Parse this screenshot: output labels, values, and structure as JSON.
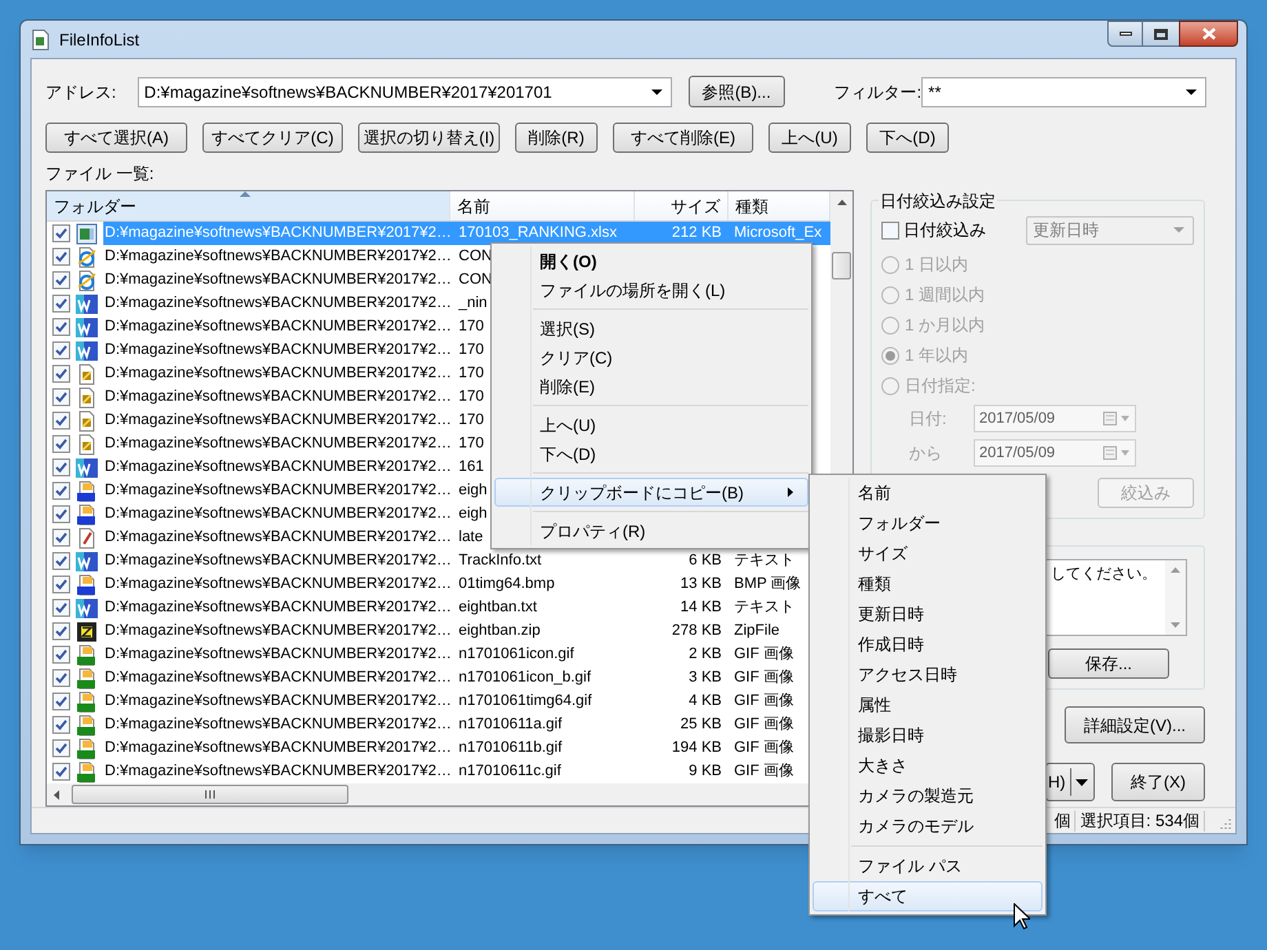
{
  "window": {
    "title": "FileInfoList"
  },
  "address": {
    "label": "アドレス:",
    "value": "D:¥magazine¥softnews¥BACKNUMBER¥2017¥201701"
  },
  "browse_button": "参照(B)...",
  "filter": {
    "label": "フィルター:",
    "value": "**"
  },
  "toolbar": [
    "すべて選択(A)",
    "すべてクリア(C)",
    "選択の切り替え(I)",
    "削除(R)",
    "すべて削除(E)",
    "上へ(U)",
    "下へ(D)"
  ],
  "list_label": "ファイル 一覧:",
  "table": {
    "columns": [
      "フォルダー",
      "名前",
      "サイズ",
      "種類"
    ],
    "rows": [
      {
        "kind": "excel",
        "checked": true,
        "selected": true,
        "folder": "D:¥magazine¥softnews¥BACKNUMBER¥2017¥2…",
        "name": "170103_RANKING.xlsx",
        "size": "212 KB",
        "type": "Microsoft_Ex"
      },
      {
        "kind": "web",
        "checked": true,
        "selected": false,
        "folder": "D:¥magazine¥softnews¥BACKNUMBER¥2017¥2…",
        "name": "CON"
      },
      {
        "kind": "web",
        "checked": true,
        "selected": false,
        "folder": "D:¥magazine¥softnews¥BACKNUMBER¥2017¥2…",
        "name": "CON"
      },
      {
        "kind": "wz",
        "checked": true,
        "selected": false,
        "folder": "D:¥magazine¥softnews¥BACKNUMBER¥2017¥2…",
        "name": "_nin"
      },
      {
        "kind": "wz",
        "checked": true,
        "selected": false,
        "folder": "D:¥magazine¥softnews¥BACKNUMBER¥2017¥2…",
        "name": "170"
      },
      {
        "kind": "wz",
        "checked": true,
        "selected": false,
        "folder": "D:¥magazine¥softnews¥BACKNUMBER¥2017¥2…",
        "name": "170"
      },
      {
        "kind": "script",
        "checked": true,
        "selected": false,
        "folder": "D:¥magazine¥softnews¥BACKNUMBER¥2017¥2…",
        "name": "170"
      },
      {
        "kind": "script",
        "checked": true,
        "selected": false,
        "folder": "D:¥magazine¥softnews¥BACKNUMBER¥2017¥2…",
        "name": "170"
      },
      {
        "kind": "script",
        "checked": true,
        "selected": false,
        "folder": "D:¥magazine¥softnews¥BACKNUMBER¥2017¥2…",
        "name": "170"
      },
      {
        "kind": "script",
        "checked": true,
        "selected": false,
        "folder": "D:¥magazine¥softnews¥BACKNUMBER¥2017¥2…",
        "name": "170"
      },
      {
        "kind": "wz",
        "checked": true,
        "selected": false,
        "folder": "D:¥magazine¥softnews¥BACKNUMBER¥2017¥2…",
        "name": "161"
      },
      {
        "kind": "bmp",
        "checked": true,
        "selected": false,
        "folder": "D:¥magazine¥softnews¥BACKNUMBER¥2017¥2…",
        "name": "eigh"
      },
      {
        "kind": "bmp",
        "checked": true,
        "selected": false,
        "folder": "D:¥magazine¥softnews¥BACKNUMBER¥2017¥2…",
        "name": "eigh"
      },
      {
        "kind": "text",
        "checked": true,
        "selected": false,
        "folder": "D:¥magazine¥softnews¥BACKNUMBER¥2017¥2…",
        "name": "late"
      },
      {
        "kind": "wz",
        "checked": true,
        "selected": false,
        "folder": "D:¥magazine¥softnews¥BACKNUMBER¥2017¥2…",
        "name": "TrackInfo.txt",
        "size": "6 KB",
        "type": "テキスト"
      },
      {
        "kind": "bmp",
        "checked": true,
        "selected": false,
        "folder": "D:¥magazine¥softnews¥BACKNUMBER¥2017¥2…",
        "name": "01timg64.bmp",
        "size": "13 KB",
        "type": "BMP 画像"
      },
      {
        "kind": "wz",
        "checked": true,
        "selected": false,
        "folder": "D:¥magazine¥softnews¥BACKNUMBER¥2017¥2…",
        "name": "eightban.txt",
        "size": "14 KB",
        "type": "テキスト"
      },
      {
        "kind": "zip",
        "checked": true,
        "selected": false,
        "folder": "D:¥magazine¥softnews¥BACKNUMBER¥2017¥2…",
        "name": "eightban.zip",
        "size": "278 KB",
        "type": "ZipFile"
      },
      {
        "kind": "gif",
        "checked": true,
        "selected": false,
        "folder": "D:¥magazine¥softnews¥BACKNUMBER¥2017¥2…",
        "name": "n1701061icon.gif",
        "size": "2 KB",
        "type": "GIF 画像"
      },
      {
        "kind": "gif",
        "checked": true,
        "selected": false,
        "folder": "D:¥magazine¥softnews¥BACKNUMBER¥2017¥2…",
        "name": "n1701061icon_b.gif",
        "size": "3 KB",
        "type": "GIF 画像"
      },
      {
        "kind": "gif",
        "checked": true,
        "selected": false,
        "folder": "D:¥magazine¥softnews¥BACKNUMBER¥2017¥2…",
        "name": "n1701061timg64.gif",
        "size": "4 KB",
        "type": "GIF 画像"
      },
      {
        "kind": "gif",
        "checked": true,
        "selected": false,
        "folder": "D:¥magazine¥softnews¥BACKNUMBER¥2017¥2…",
        "name": "n17010611a.gif",
        "size": "25 KB",
        "type": "GIF 画像"
      },
      {
        "kind": "gif",
        "checked": true,
        "selected": false,
        "folder": "D:¥magazine¥softnews¥BACKNUMBER¥2017¥2…",
        "name": "n17010611b.gif",
        "size": "194 KB",
        "type": "GIF 画像"
      },
      {
        "kind": "gif",
        "checked": true,
        "selected": false,
        "folder": "D:¥magazine¥softnews¥BACKNUMBER¥2017¥2…",
        "name": "n17010611c.gif",
        "size": "9 KB",
        "type": "GIF 画像"
      }
    ]
  },
  "context_menu": {
    "groups": [
      [
        {
          "label": "開く(O)",
          "default": true,
          "selected": false,
          "submenu": false
        },
        {
          "label": "ファイルの場所を開く(L)",
          "default": false,
          "selected": false,
          "submenu": false
        }
      ],
      [
        {
          "label": "選択(S)",
          "default": false,
          "selected": false,
          "submenu": false
        },
        {
          "label": "クリア(C)",
          "default": false,
          "selected": false,
          "submenu": false
        },
        {
          "label": "削除(E)",
          "default": false,
          "selected": false,
          "submenu": false
        }
      ],
      [
        {
          "label": "上へ(U)",
          "default": false,
          "selected": false,
          "submenu": false
        },
        {
          "label": "下へ(D)",
          "default": false,
          "selected": false,
          "submenu": false
        }
      ],
      [
        {
          "label": "クリップボードにコピー(B)",
          "default": false,
          "selected": true,
          "submenu": true
        }
      ],
      [
        {
          "label": "プロパティ(R)",
          "default": false,
          "selected": false,
          "submenu": false
        }
      ]
    ]
  },
  "submenu": {
    "groups": [
      [
        {
          "label": "名前",
          "selected": false
        },
        {
          "label": "フォルダー",
          "selected": false
        },
        {
          "label": "サイズ",
          "selected": false
        },
        {
          "label": "種類",
          "selected": false
        },
        {
          "label": "更新日時",
          "selected": false
        },
        {
          "label": "作成日時",
          "selected": false
        },
        {
          "label": "アクセス日時",
          "selected": false
        },
        {
          "label": "属性",
          "selected": false
        },
        {
          "label": "撮影日時",
          "selected": false
        },
        {
          "label": "大きさ",
          "selected": false
        },
        {
          "label": "カメラの製造元",
          "selected": false
        },
        {
          "label": "カメラのモデル",
          "selected": false
        }
      ],
      [
        {
          "label": "ファイル パス",
          "selected": false
        },
        {
          "label": "すべて",
          "selected": true
        }
      ]
    ]
  },
  "date_filter": {
    "title": "日付絞込み設定",
    "disabled": true,
    "checkbox": {
      "label": "日付絞込み",
      "checked": false
    },
    "field": "更新日時",
    "options": [
      {
        "label": "1 日以内",
        "selected": false
      },
      {
        "label": "1 週間以内",
        "selected": false
      },
      {
        "label": "1 か月以内",
        "selected": false
      },
      {
        "label": "1 年以内",
        "selected": true
      },
      {
        "label": "日付指定:",
        "selected": false
      }
    ],
    "dates": [
      {
        "label": "日付:",
        "value": "2017/05/09"
      },
      {
        "label": "から",
        "value": "2017/05/09"
      }
    ],
    "apply_button": "絞込み"
  },
  "note": {
    "text": "してください。",
    "save_button": "保存..."
  },
  "settings_button": "詳細設定(V)...",
  "split_button": "H)",
  "exit_button": "終了(X)",
  "status_bar": [
    "個",
    "選択項目: 534個"
  ]
}
